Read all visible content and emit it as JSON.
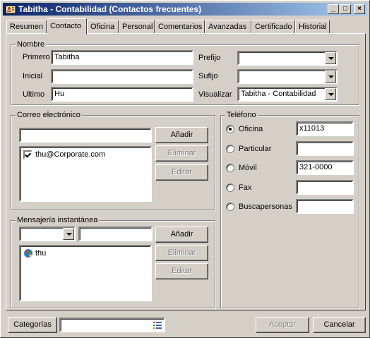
{
  "window": {
    "title": "Tabitha - Contabilidad (Contactos frecuentes)",
    "minimize": "_",
    "maximize": "□",
    "close": "×"
  },
  "tabs": [
    {
      "label": "Resumen"
    },
    {
      "label": "Contacto",
      "active": true
    },
    {
      "label": "Oficina"
    },
    {
      "label": "Personal"
    },
    {
      "label": "Comentarios"
    },
    {
      "label": "Avanzadas"
    },
    {
      "label": "Certificado"
    },
    {
      "label": "Historial"
    }
  ],
  "nombre": {
    "group_title": "Nombre",
    "primero_label": "Primero",
    "primero_value": "Tabitha",
    "inicial_label": "Inicial",
    "inicial_value": "",
    "ultimo_label": "Ultimo",
    "ultimo_value": "Hu",
    "prefijo_label": "Prefijo",
    "prefijo_value": "",
    "sufijo_label": "Sufijo",
    "sufijo_value": "",
    "visualizar_label": "Visualizar",
    "visualizar_value": "Tabitha - Contabilidad"
  },
  "correo": {
    "group_title": "Correo electrónico",
    "input_value": "",
    "items": [
      "thu@Corporate.com"
    ],
    "add_label": "Añadir",
    "remove_label": "Eliminar",
    "edit_label": "Editar"
  },
  "mensajeria": {
    "group_title": "Mensajería instantánea",
    "service_value": "",
    "input_value": "",
    "items": [
      "thu"
    ],
    "add_label": "Añadir",
    "remove_label": "Eliminar",
    "edit_label": "Editar"
  },
  "telefono": {
    "group_title": "Teléfono",
    "options": [
      {
        "label": "Oficina",
        "value": "x11013",
        "checked": true
      },
      {
        "label": "Particular",
        "value": ""
      },
      {
        "label": "Móvil",
        "value": "321-0000"
      },
      {
        "label": "Fax",
        "value": ""
      },
      {
        "label": "Buscapersonas",
        "value": ""
      }
    ]
  },
  "footer": {
    "categorias_label": "Categorías",
    "categorias_value": "",
    "aceptar_label": "Aceptar",
    "cancelar_label": "Cancelar"
  }
}
